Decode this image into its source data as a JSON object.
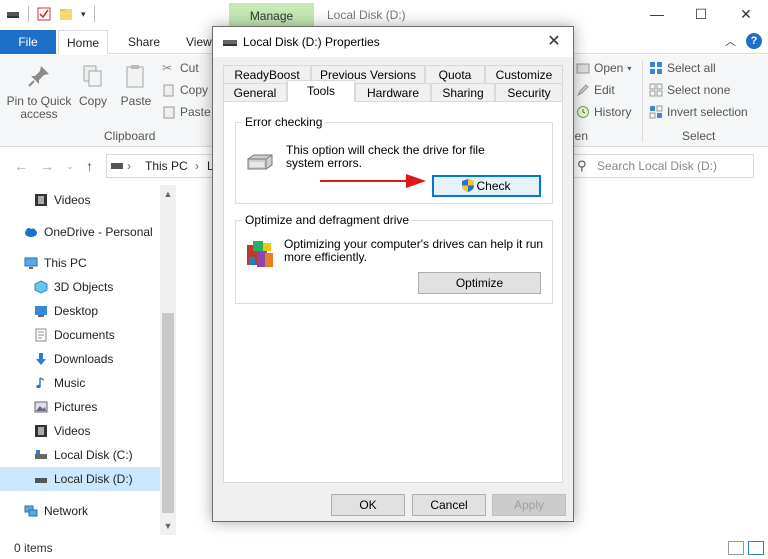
{
  "explorer": {
    "manage_tab": "Manage",
    "window_title": "Local Disk (D:)",
    "tabs": [
      "File",
      "Home",
      "Share",
      "View"
    ],
    "ribbon": {
      "pin_label": "Pin to Quick access",
      "copy_label": "Copy",
      "paste_label": "Paste",
      "cut_label": "Cut",
      "copy_path_label": "Copy p",
      "paste_shortcut_label": "Paste s",
      "clipboard_group": "Clipboard",
      "open_label": "Open",
      "edit_label": "Edit",
      "history_label": "History",
      "open_group_partial": "pen",
      "select_all_label": "Select all",
      "select_none_label": "Select none",
      "invert_selection_label": "Invert selection",
      "select_group": "Select"
    },
    "address": {
      "crumb1": "This PC",
      "crumb2": "L"
    },
    "search_placeholder": "Search Local Disk (D:)",
    "nav_items": [
      {
        "label": "Videos",
        "icon": "film-icon"
      },
      {
        "label": "OneDrive - Personal",
        "icon": "cloud-icon"
      },
      {
        "label": "This PC",
        "icon": "monitor-icon"
      },
      {
        "label": "3D Objects",
        "icon": "cube-icon"
      },
      {
        "label": "Desktop",
        "icon": "desktop-icon"
      },
      {
        "label": "Documents",
        "icon": "document-icon"
      },
      {
        "label": "Downloads",
        "icon": "download-arrow-icon"
      },
      {
        "label": "Music",
        "icon": "music-note-icon"
      },
      {
        "label": "Pictures",
        "icon": "picture-icon"
      },
      {
        "label": "Videos",
        "icon": "film-icon"
      },
      {
        "label": "Local Disk (C:)",
        "icon": "drive-icon"
      },
      {
        "label": "Local Disk (D:)",
        "icon": "drive-icon"
      },
      {
        "label": "Network",
        "icon": "network-icon"
      }
    ],
    "status": "0 items"
  },
  "dialog": {
    "title": "Local Disk (D:) Properties",
    "tabs_row1": [
      "ReadyBoost",
      "Previous Versions",
      "Quota",
      "Customize"
    ],
    "tabs_row2": [
      "General",
      "Tools",
      "Hardware",
      "Sharing",
      "Security"
    ],
    "active_tab": "Tools",
    "error_checking": {
      "label": "Error checking",
      "text": "This option will check the drive for file system errors.",
      "button": "Check"
    },
    "optimize": {
      "label": "Optimize and defragment drive",
      "text": "Optimizing your computer's drives can help it run more efficiently.",
      "button": "Optimize"
    },
    "ok": "OK",
    "cancel": "Cancel",
    "apply": "Apply"
  },
  "colors": {
    "accent": "#1e6fc7",
    "manage_tab": "#c5e8b4",
    "focus_border": "#0078d7",
    "annotation_arrow": "#e0151b"
  }
}
